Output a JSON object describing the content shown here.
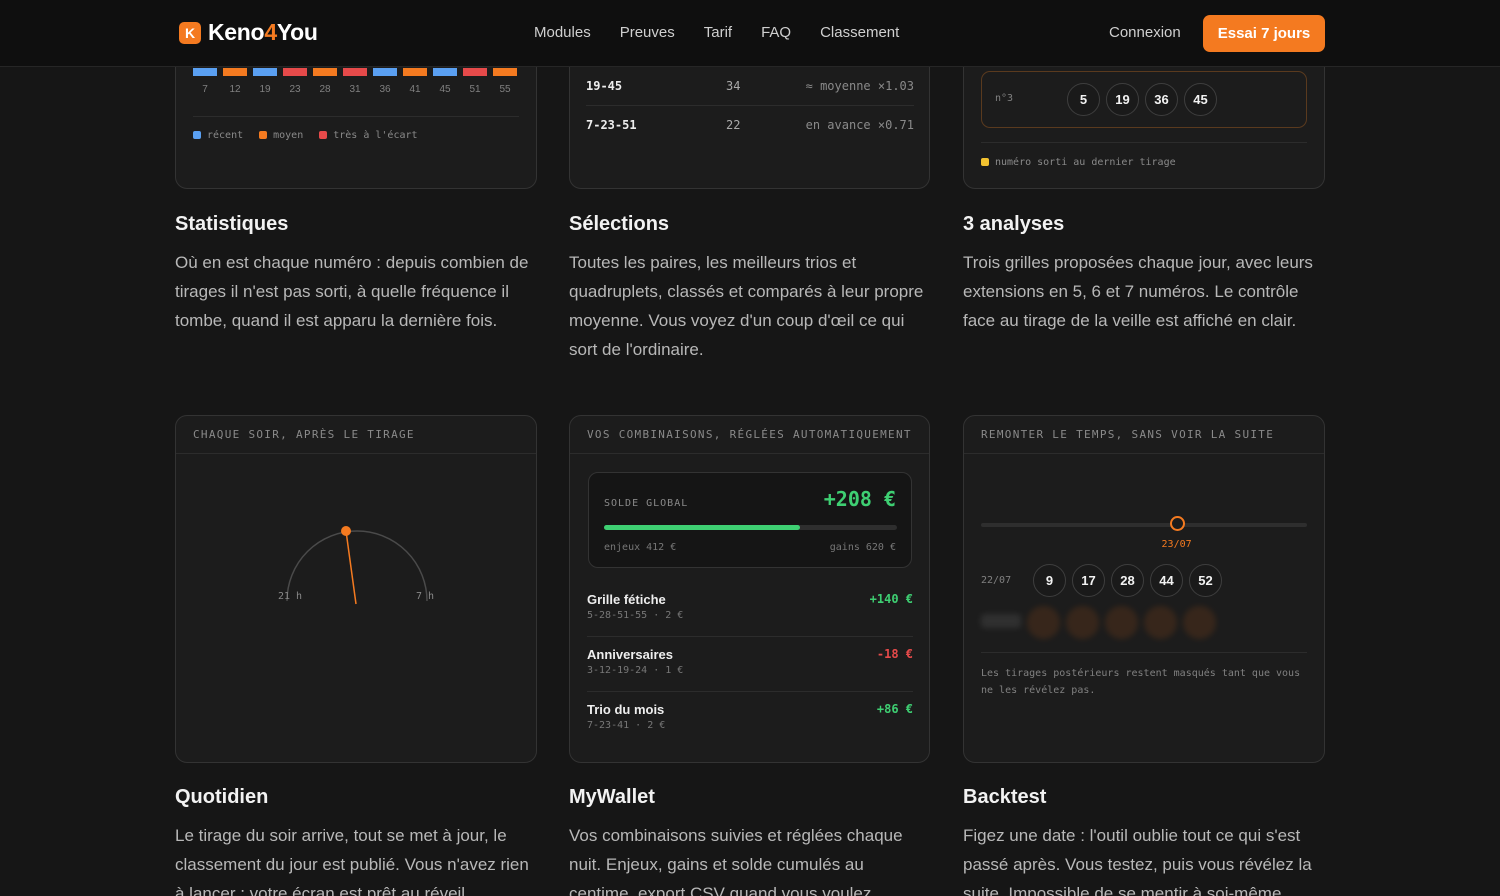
{
  "brand": {
    "pre": "Keno",
    "accent": "4",
    "post": "You",
    "mark": "K"
  },
  "nav": [
    "Modules",
    "Preuves",
    "Tarif",
    "FAQ",
    "Classement"
  ],
  "login": "Connexion",
  "cta": "Essai 7 jours",
  "colors": {
    "accent": "#f47a20",
    "recent": "#5aa0f2",
    "medium": "#f47a20",
    "far": "#e64a4a",
    "positive": "#3ecf72",
    "negative": "#e64a4a",
    "highlight": "#f2c230"
  },
  "stats_card": {
    "bar_colors": [
      "recent",
      "medium",
      "recent",
      "far",
      "medium",
      "far",
      "recent",
      "medium",
      "recent",
      "far",
      "medium"
    ],
    "ticks": [
      "7",
      "12",
      "19",
      "23",
      "28",
      "31",
      "36",
      "41",
      "45",
      "51",
      "55"
    ],
    "legend": [
      "récent",
      "moyen",
      "très à l'écart"
    ]
  },
  "selections_card": {
    "rows": [
      {
        "combo": "19-45",
        "count": "34",
        "compare": "≈ moyenne ×1.03"
      },
      {
        "combo": "7-23-51",
        "count": "22",
        "compare": "en avance ×0.71"
      }
    ]
  },
  "analyses_card": {
    "row_label": "n°3",
    "balls": [
      "5",
      "19",
      "36",
      "45"
    ],
    "legend": "numéro sorti au dernier tirage"
  },
  "features_top": [
    {
      "title": "Statistiques",
      "desc": "Où en est chaque numéro : depuis combien de tirages il n'est pas sorti, à quelle fréquence il tombe, quand il est apparu la dernière fois."
    },
    {
      "title": "Sélections",
      "desc": "Toutes les paires, les meilleurs trios et quadruplets, classés et comparés à leur propre moyenne. Vous voyez d'un coup d'œil ce qui sort de l'ordinaire."
    },
    {
      "title": "3 analyses",
      "desc": "Trois grilles proposées chaque jour, avec leurs extensions en 5, 6 et 7 numéros. Le contrôle face au tirage de la veille est affiché en clair."
    }
  ],
  "daily_card": {
    "header": "CHAQUE SOIR, APRÈS LE TIRAGE",
    "left_label": "21 h",
    "right_label": "7 h"
  },
  "wallet_card": {
    "header": "VOS COMBINAISONS, RÉGLÉES AUTOMATIQUEMENT",
    "balance_label": "SOLDE GLOBAL",
    "balance": "+208 €",
    "progress": 0.67,
    "stakes": "enjeux 412 €",
    "gains": "gains 620 €",
    "rows": [
      {
        "name": "Grille fétiche",
        "sub": "5-28-51-55 · 2 €",
        "amount": "+140 €",
        "sign": "positive"
      },
      {
        "name": "Anniversaires",
        "sub": "3-12-19-24 · 1 €",
        "amount": "-18 €",
        "sign": "negative"
      },
      {
        "name": "Trio du mois",
        "sub": "7-23-41 · 2 €",
        "amount": "+86 €",
        "sign": "positive"
      }
    ]
  },
  "backtest_card": {
    "header": "REMONTER LE TEMPS, SANS VOIR LA SUITE",
    "slider_date": "23/07",
    "slider_value": 0.6,
    "row_date": "22/07",
    "balls": [
      "9",
      "17",
      "28",
      "44",
      "52"
    ],
    "note": "Les tirages postérieurs restent masqués tant que vous ne les révélez pas."
  },
  "features_bottom": [
    {
      "title": "Quotidien",
      "desc": "Le tirage du soir arrive, tout se met à jour, le classement du jour est publié. Vous n'avez rien à lancer : votre écran est prêt au réveil."
    },
    {
      "title": "MyWallet",
      "desc": "Vos combinaisons suivies et réglées chaque nuit. Enjeux, gains et solde cumulés au centime, export CSV quand vous voulez."
    },
    {
      "title": "Backtest",
      "desc": "Figez une date : l'outil oublie tout ce qui s'est passé après. Vous testez, puis vous révélez la suite. Impossible de se mentir à soi-même."
    }
  ]
}
